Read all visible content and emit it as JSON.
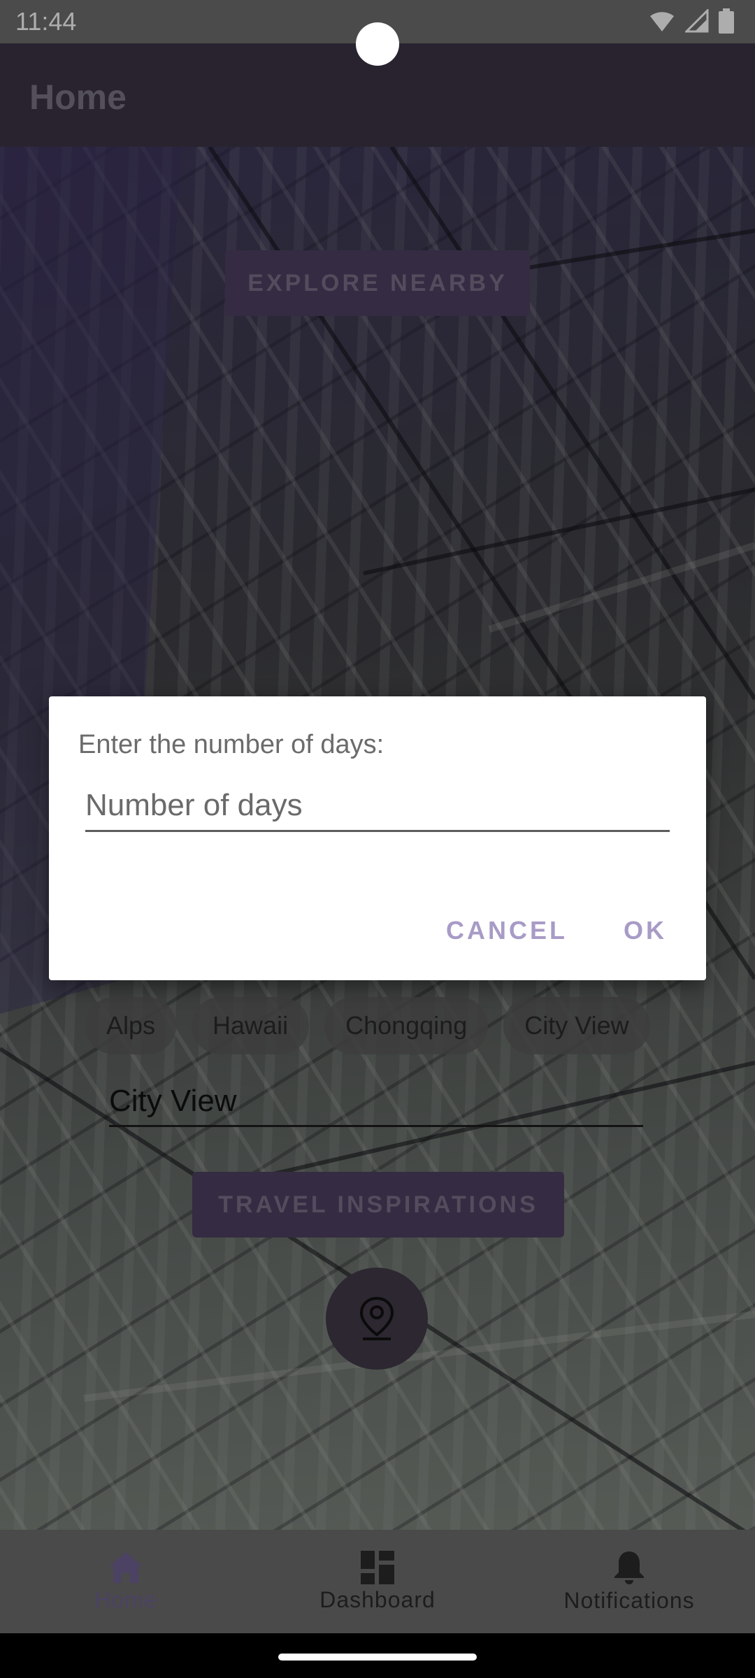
{
  "status_bar": {
    "time": "11:44",
    "icons": [
      "wifi-icon",
      "signal-icon",
      "battery-icon"
    ]
  },
  "app_bar": {
    "title": "Home"
  },
  "content": {
    "explore_button": "EXPLORE NEARBY",
    "chips": [
      "Alps",
      "Hawaii",
      "Chongqing",
      "City View"
    ],
    "city_input_value": "City View",
    "travel_button": "TRAVEL INSPIRATIONS",
    "fab_icon": "location-pin-icon"
  },
  "dialog": {
    "message": "Enter the number of days:",
    "input_placeholder": "Number of days",
    "input_value": "",
    "cancel_label": "CANCEL",
    "ok_label": "OK"
  },
  "bottom_nav": {
    "items": [
      {
        "label": "Home",
        "icon": "home-icon",
        "active": true
      },
      {
        "label": "Dashboard",
        "icon": "dashboard-icon",
        "active": false
      },
      {
        "label": "Notifications",
        "icon": "bell-icon",
        "active": false
      }
    ]
  },
  "colors": {
    "accent": "#a89bc6",
    "app_bar": "#3d3448",
    "button_bg": "#4e4062"
  }
}
